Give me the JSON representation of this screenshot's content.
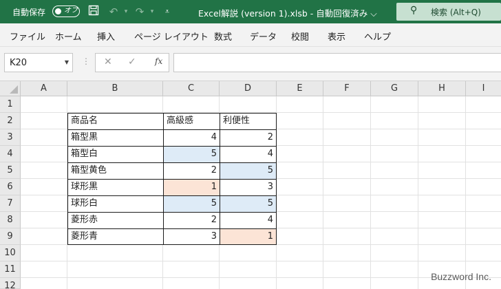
{
  "titlebar": {
    "autosave_label": "自動保存",
    "toggle_label": "オフ",
    "quick_access": [
      "save-icon",
      "undo-icon",
      "redo-icon",
      "customize-icon"
    ],
    "title": "Excel解説 (version 1).xlsb  -  自動回復済み ⌵",
    "search_placeholder": "検索 (Alt+Q)",
    "accent_color": "#217346"
  },
  "ribbon": {
    "tabs": [
      "ファイル",
      "ホーム",
      "挿入",
      "ページ レイアウト",
      "数式",
      "データ",
      "校閲",
      "表示",
      "ヘルプ"
    ]
  },
  "formula_bar": {
    "name_box": "K20",
    "cancel": "✕",
    "enter": "✓",
    "fx": "fx",
    "formula": ""
  },
  "sheet": {
    "columns": [
      "A",
      "B",
      "C",
      "D",
      "E",
      "F",
      "G",
      "H",
      "I"
    ],
    "rows": [
      "1",
      "2",
      "3",
      "4",
      "5",
      "6",
      "7",
      "8",
      "9",
      "10",
      "11",
      "12"
    ],
    "table": {
      "headers": [
        "商品名",
        "高級感",
        "利便性"
      ],
      "rows": [
        {
          "name": "箱型黒",
          "c": "4",
          "d": "2"
        },
        {
          "name": "箱型白",
          "c": "5",
          "d": "4"
        },
        {
          "name": "箱型黄色",
          "c": "2",
          "d": "5"
        },
        {
          "name": "球形黒",
          "c": "1",
          "d": "3"
        },
        {
          "name": "球形白",
          "c": "5",
          "d": "5"
        },
        {
          "name": "菱形赤",
          "c": "2",
          "d": "4"
        },
        {
          "name": "菱形青",
          "c": "3",
          "d": "1"
        }
      ],
      "highlight_blue": "#deebf7",
      "highlight_orange": "#fce4d6"
    }
  },
  "watermark": "Buzzword Inc."
}
